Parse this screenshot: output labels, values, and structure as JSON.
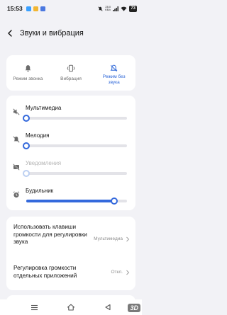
{
  "status_bar": {
    "time": "15:53",
    "net_speed": "28,0\nКБ/с",
    "battery": "73"
  },
  "header": {
    "title": "Звуки и вибрация"
  },
  "sound_modes": [
    {
      "label": "Режим звонка",
      "icon": "bell-icon",
      "active": false
    },
    {
      "label": "Вибрация",
      "icon": "vibration-icon",
      "active": false
    },
    {
      "label": "Режим без звука",
      "icon": "bell-muted-icon",
      "active": true
    }
  ],
  "volume": [
    {
      "label": "Мультимедиа",
      "icon": "speaker-muted-icon",
      "level": 0,
      "enabled": true
    },
    {
      "label": "Мелодия",
      "icon": "bell-muted-icon",
      "level": 0,
      "enabled": true
    },
    {
      "label": "Уведомления",
      "icon": "notification-muted-icon",
      "level": 0,
      "enabled": false
    },
    {
      "label": "Будильник",
      "icon": "alarm-clock-icon",
      "level": 0.87,
      "enabled": true
    }
  ],
  "settings": [
    {
      "label": "Использовать клавиши громкости для регулировки звука",
      "value": "Мультимедиа"
    },
    {
      "label": "Регулировка громкости отдельных приложений",
      "value": "Откл."
    }
  ],
  "colors": {
    "accent": "#3469dc",
    "accent_disabled": "#bdd0f2",
    "background": "#f2f2f6",
    "card": "#ffffff"
  },
  "watermark": "3D"
}
